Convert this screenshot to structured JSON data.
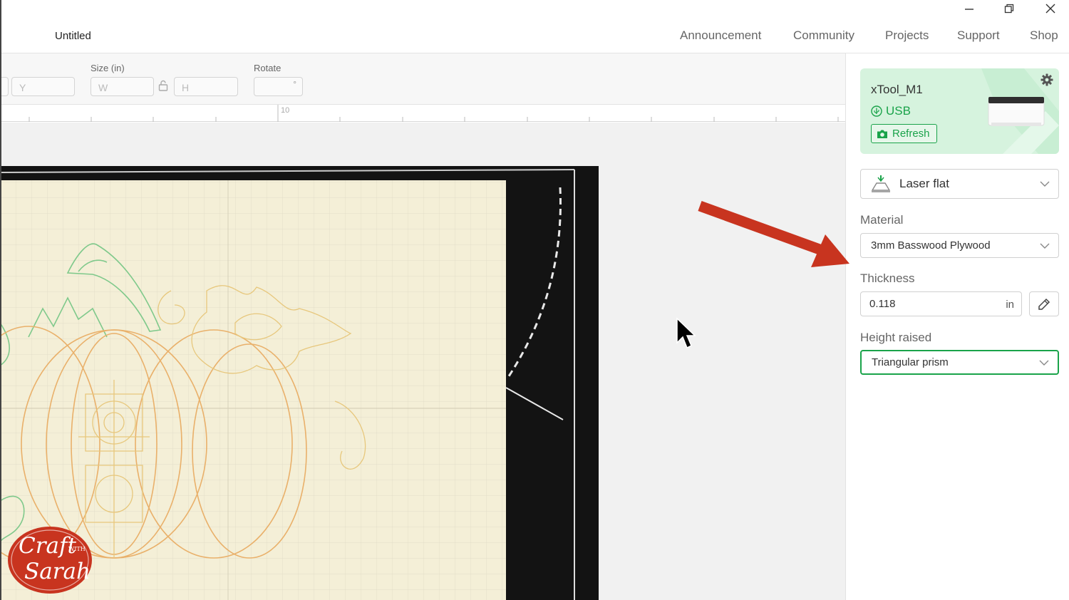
{
  "window": {
    "title": "Untitled",
    "nav": [
      "Announcement",
      "Community",
      "Projects",
      "Support",
      "Shop"
    ],
    "controls": [
      "minimize-icon",
      "restore-icon",
      "close-icon"
    ]
  },
  "toolbar": {
    "position_y_placeholder": "Y",
    "size_label": "Size (in)",
    "width_placeholder": "W",
    "height_placeholder": "H",
    "rotate_label": "Rotate",
    "rotate_unit": "°"
  },
  "ruler": {
    "marks": [
      "10"
    ]
  },
  "device": {
    "name": "xTool_M1",
    "connection": "USB",
    "refresh_label": "Refresh"
  },
  "settings": {
    "mode": "Laser flat",
    "material_label": "Material",
    "material_value": "3mm Basswood Plywood",
    "thickness_label": "Thickness",
    "thickness_value": "0.118",
    "thickness_unit": "in",
    "height_label": "Height raised",
    "height_value": "Triangular prism"
  },
  "watermark": {
    "line1": "Craft",
    "with": "WITH",
    "line2": "Sarah"
  },
  "colors": {
    "accent_green": "#1aa34a",
    "arrow_red": "#c8341f",
    "logo_red": "#c8341f"
  }
}
